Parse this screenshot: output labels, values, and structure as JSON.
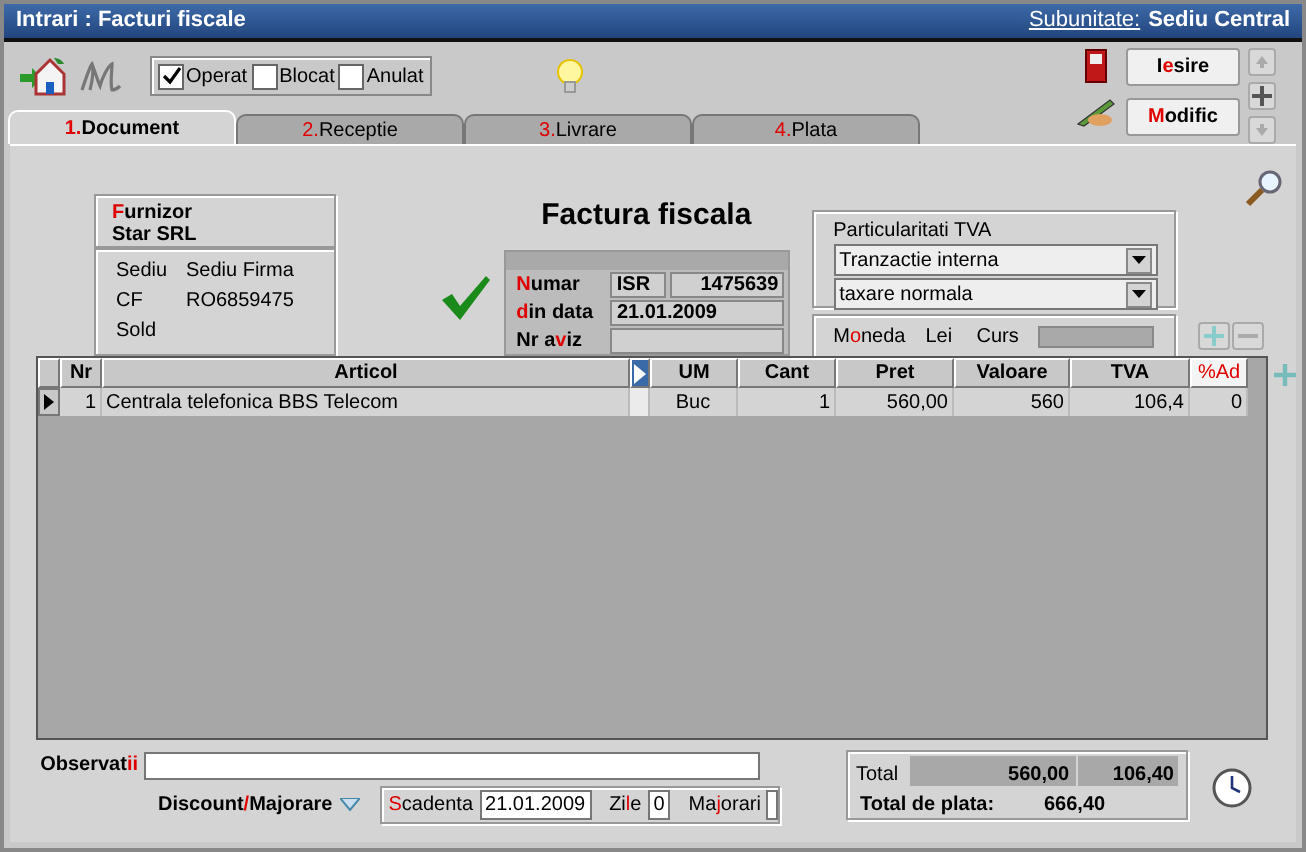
{
  "window": {
    "title": "Intrari : Facturi fiscale",
    "subunit_label": "Subunitate:",
    "subunit": "Sediu Central"
  },
  "toolbar": {
    "flags": [
      {
        "label": "Operat",
        "checked": true
      },
      {
        "label": "Blocat",
        "checked": false
      },
      {
        "label": "Anulat",
        "checked": false
      }
    ],
    "buttons": [
      {
        "label": {
          "before": "I",
          "hot": "e",
          "after": "sire"
        }
      },
      {
        "label": {
          "hot": "M",
          "after": "odific"
        }
      }
    ]
  },
  "tabs": [
    {
      "label": {
        "hot": "1.",
        "after": "Document"
      },
      "selected": true
    },
    {
      "label": {
        "hot": "2.",
        "after": "Receptie"
      },
      "selected": false
    },
    {
      "label": {
        "hot": "3.",
        "after": "Livrare"
      },
      "selected": false
    },
    {
      "label": {
        "hot": "4.",
        "after": "Plata"
      },
      "selected": false
    }
  ],
  "supplier": {
    "heading": {
      "hot": "F",
      "after": "urnizor"
    },
    "name": "Star SRL",
    "fields": [
      {
        "label": "Sediu",
        "value": "Sediu Firma"
      },
      {
        "label": "CF",
        "value": "RO6859475"
      },
      {
        "label": "Sold"
      }
    ]
  },
  "document": {
    "title": "Factura fiscala",
    "validated": true,
    "fields": [
      {
        "label": {
          "hot": "N",
          "after": "umar"
        },
        "series": "ISR",
        "value": "1475639"
      },
      {
        "label": {
          "hot": "d",
          "after": "in data"
        },
        "value": "21.01.2009"
      },
      {
        "label": {
          "before": "Nr a",
          "hot": "v",
          "after": "iz"
        }
      }
    ]
  },
  "vat": {
    "heading": "Particularitati TVA",
    "options": [
      "Tranzactie interna",
      "taxare normala"
    ]
  },
  "currency": {
    "label": {
      "before": "M",
      "hot": "o",
      "after": "neda"
    },
    "value": "Lei",
    "rate_label": "Curs"
  },
  "table": {
    "columns": [
      {
        "label": "Nr",
        "highlight": false
      },
      {
        "label": "Articol",
        "highlight": false
      },
      {
        "label": "UM",
        "highlight": false
      },
      {
        "label": "Cant",
        "highlight": false
      },
      {
        "label": "Pret",
        "highlight": false
      },
      {
        "label": "Valoare",
        "highlight": false
      },
      {
        "label": "TVA",
        "highlight": false
      },
      {
        "label": "%Ad",
        "highlight": true
      }
    ],
    "rows": [
      {
        "current": true,
        "cells": [
          "1",
          "Centrala telefonica BBS Telecom",
          "Buc",
          "1",
          "560,00",
          "560",
          "106,4",
          "0"
        ]
      }
    ]
  },
  "footer": {
    "notes_label": {
      "before": "Observat",
      "hot": "ii"
    },
    "discount_label": {
      "before": "Discount",
      "hot": "/",
      "after": "Majorare"
    },
    "due": [
      {
        "label": {
          "hot": "S",
          "after": "cadenta"
        },
        "value": "21.01.2009"
      },
      {
        "label": {
          "before": "Zi",
          "hot": "l",
          "after": "e"
        },
        "value": "0"
      },
      {
        "label": {
          "before": "Ma",
          "hot": "j",
          "after": "orari"
        }
      }
    ],
    "totals": {
      "label": "Total",
      "net": "560,00",
      "vat": "106,40",
      "grand_label": "Total de plata:",
      "grand": "666,40"
    }
  }
}
